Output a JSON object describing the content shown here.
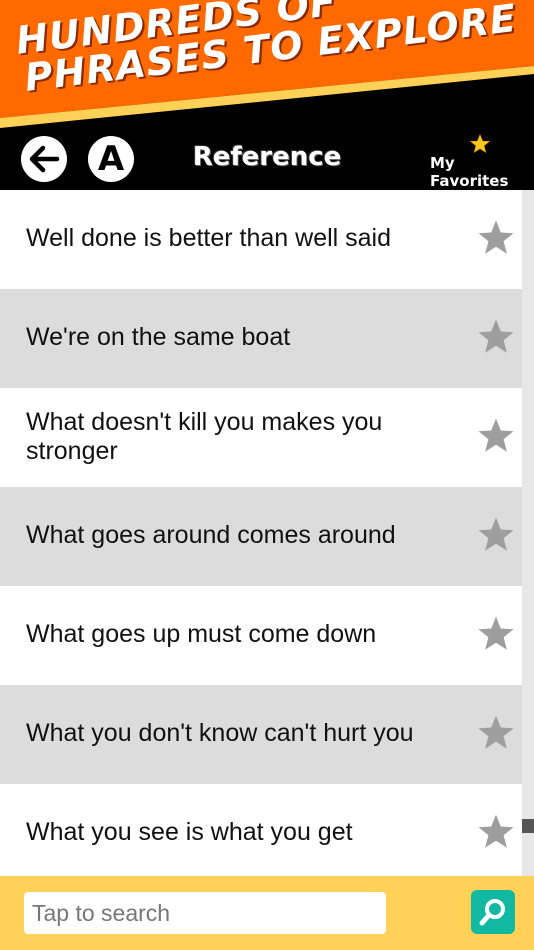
{
  "banner": {
    "line1": "HUNDREDS OF",
    "line2": "PHRASES TO EXPLORE"
  },
  "toolbar": {
    "title": "Reference",
    "alpha_label": "A",
    "favorites_label": "My Favorites"
  },
  "phrases": [
    "Well done is better than well said",
    "We're on the same boat",
    "What doesn't kill you makes you stronger",
    "What goes around comes around",
    "What goes up must come down",
    "What you don't know can't hurt you",
    "What you see is what you get"
  ],
  "search": {
    "placeholder": "Tap to search"
  },
  "colors": {
    "banner_orange": "#ff6a00",
    "banner_stripe": "#ffd257",
    "row_grey": "#dcdcdc",
    "star_grey": "#9e9e9e",
    "favorites_star": "#ffc61a",
    "search_bar": "#ffd257",
    "search_button": "#12b9a2"
  }
}
